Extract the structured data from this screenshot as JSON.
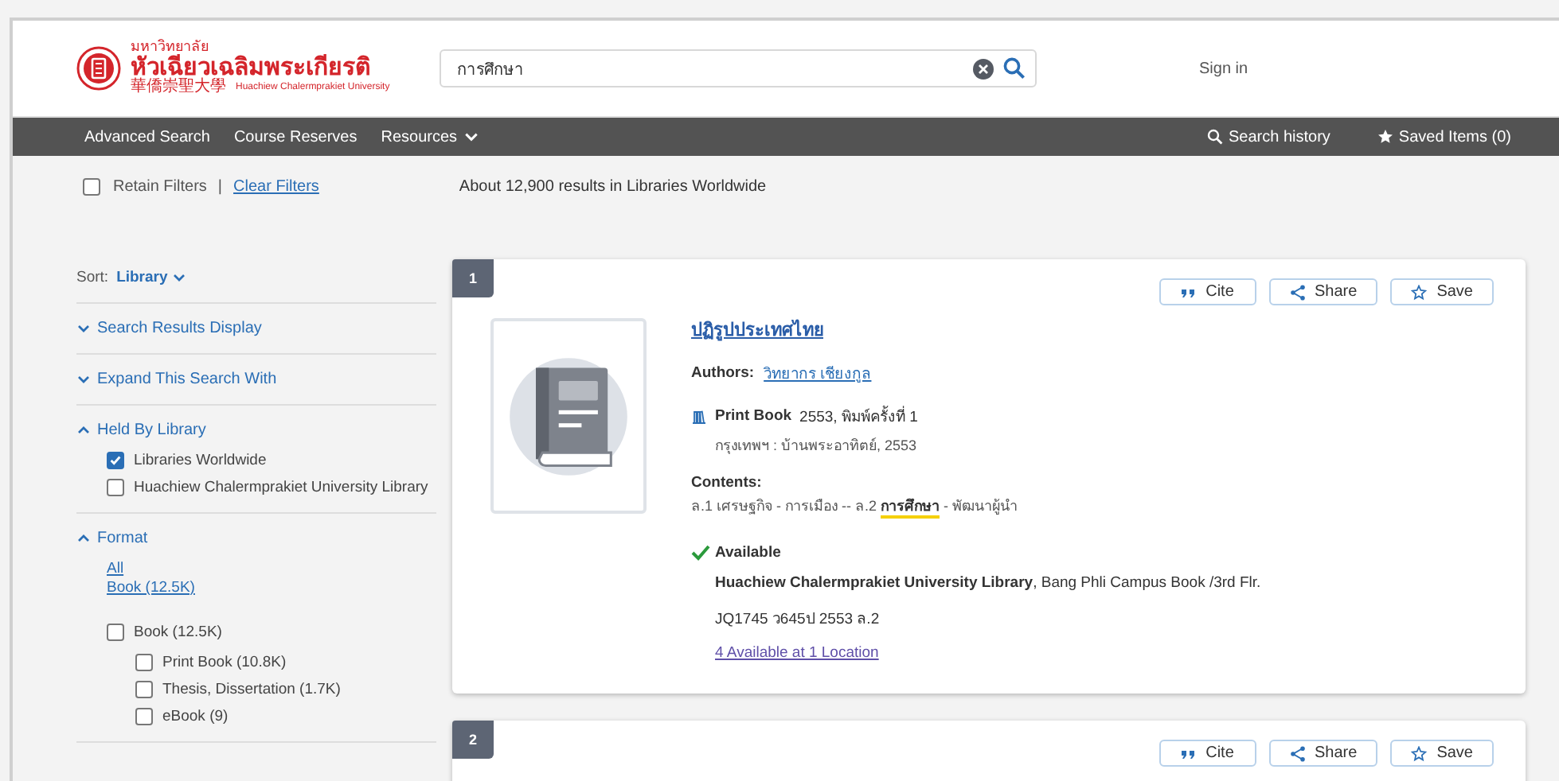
{
  "header": {
    "logo_top": "มหาวิทยาลัย",
    "logo_main": "หัวเฉียวเฉลิมพระเกียรติ",
    "logo_cjk": "華僑崇聖大學",
    "logo_en": "Huachiew Chalermprakiet University",
    "search": {
      "value": "การศึกษา"
    },
    "sign_in": "Sign in"
  },
  "nav": {
    "left": [
      {
        "label": "Advanced Search",
        "dropdown": false
      },
      {
        "label": "Course Reserves",
        "dropdown": false
      },
      {
        "label": "Resources",
        "dropdown": true
      }
    ],
    "right": [
      {
        "label": "Search history"
      },
      {
        "label": "Saved Items (0)"
      }
    ]
  },
  "filters": {
    "retain": {
      "label": "Retain Filters",
      "checked": false
    },
    "separator": "|",
    "clear": "Clear Filters",
    "summary": "About 12,900 results in Libraries Worldwide"
  },
  "sort": {
    "label": "Sort:",
    "value": "Library"
  },
  "facets": [
    {
      "title": "Search Results Display",
      "expanded": false
    },
    {
      "title": "Expand This Search With",
      "expanded": false
    },
    {
      "title": "Held By Library",
      "expanded": true,
      "options": [
        {
          "label": "Libraries Worldwide",
          "checked": true
        },
        {
          "label": "Huachiew Chalermprakiet University Library",
          "checked": false
        }
      ]
    },
    {
      "title": "Format",
      "expanded": true,
      "links": [
        "All",
        "Book (12.5K)"
      ],
      "options": [
        {
          "label": "Book (12.5K)",
          "checked": false,
          "children": [
            {
              "label": "Print Book (10.8K)",
              "checked": false
            },
            {
              "label": "Thesis, Dissertation (1.7K)",
              "checked": false
            },
            {
              "label": "eBook (9)",
              "checked": false
            }
          ]
        }
      ]
    }
  ],
  "results": [
    {
      "number": "1",
      "actions": [
        "Cite",
        "Share",
        "Save"
      ],
      "title": "ปฏิรูปประเทศไทย",
      "authors_label": "Authors:",
      "author": "วิทยากร เชียงกูล",
      "format": "Print Book",
      "edition": "2553, พิมพ์ครั้งที่ 1",
      "publisher": "กรุงเทพฯ : บ้านพระอาทิตย์, 2553",
      "contents_label": "Contents:",
      "contents": "ล.1 เศรษฐกิจ - การเมือง -- ล.2 **การศึกษา** - พัฒนาผู้นำ",
      "availability": "Available",
      "available": true,
      "library": "Huachiew Chalermprakiet University Library",
      "location": ", Bang Phli Campus Book /3rd Flr.",
      "call_number": "JQ1745 ว645ป 2553 ล.2",
      "holdings": "4 Available at 1 Location"
    },
    {
      "number": "2",
      "actions": [
        "Cite",
        "Share",
        "Save"
      ]
    }
  ]
}
